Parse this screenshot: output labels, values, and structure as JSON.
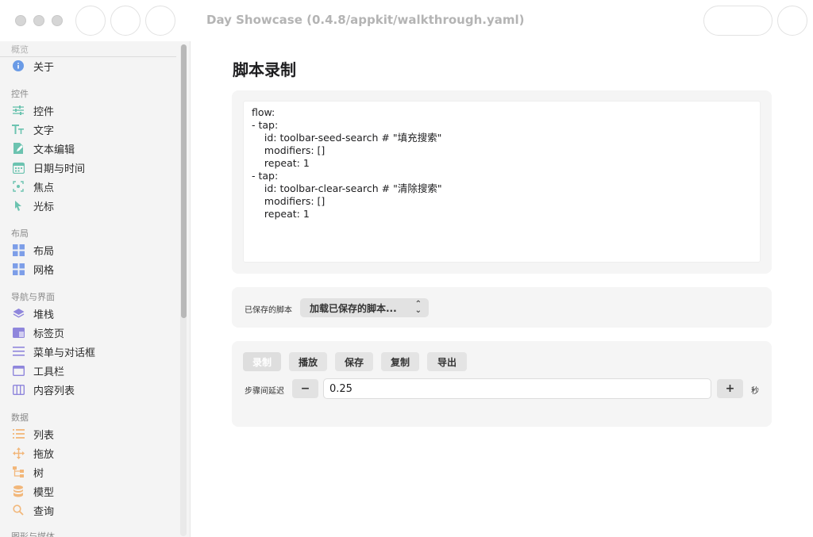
{
  "window": {
    "title": "Day Showcase (0.4.8/appkit/walkthrough.yaml)"
  },
  "sidebar": {
    "sections": {
      "overview": "概览",
      "controls": "控件",
      "layout": "布局",
      "navigation": "导航与界面",
      "data": "数据",
      "graphics": "图形与媒体"
    },
    "items": {
      "about": "关于",
      "controls": "控件",
      "text": "文字",
      "text_edit": "文本编辑",
      "datetime": "日期与时间",
      "focus": "焦点",
      "cursor": "光标",
      "layout": "布局",
      "grid": "网格",
      "stack": "堆栈",
      "tabs": "标签页",
      "menus_dialogs": "菜单与对话框",
      "toolbar": "工具栏",
      "content_list": "内容列表",
      "list": "列表",
      "drag_drop": "拖放",
      "tree": "树",
      "model": "模型",
      "query": "查询"
    }
  },
  "main": {
    "title": "脚本录制",
    "script": "flow:\n- tap:\n    id: toolbar-seed-search # \"填充搜索\"\n    modifiers: []\n    repeat: 1\n- tap:\n    id: toolbar-clear-search # \"清除搜索\"\n    modifiers: []\n    repeat: 1",
    "saved_label": "已保存的脚本",
    "saved_popup": "加载已保存的脚本...",
    "buttons": {
      "record": "录制",
      "play": "播放",
      "save": "保存",
      "copy": "复制",
      "export": "导出"
    },
    "delay_label": "步骤间延迟",
    "delay_value": "0.25",
    "minus": "−",
    "plus": "+",
    "unit": "秒"
  },
  "colors": {
    "accent_blue": "#6a9be6",
    "icon_green": "#6cc3b0",
    "icon_blue": "#7d9ee8",
    "icon_purple": "#8f86dc",
    "icon_orange": "#f2b77a"
  }
}
